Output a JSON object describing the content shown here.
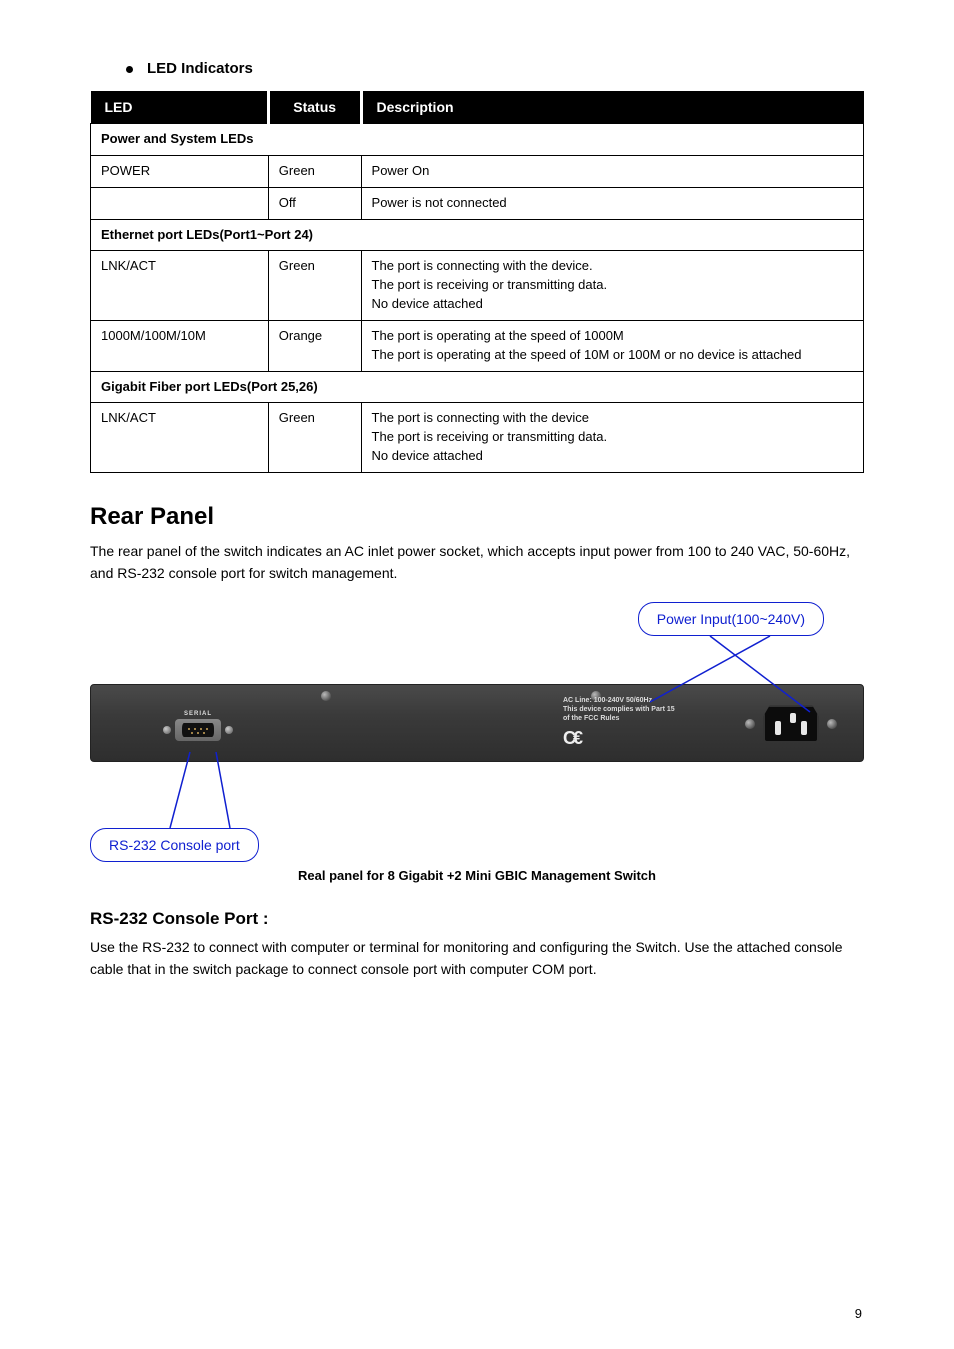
{
  "led_section": {
    "bullet_label": "LED Indicators",
    "columns": {
      "led": "LED",
      "status": "Status",
      "description": "Description"
    },
    "groups": [
      {
        "title": "Power and System LEDs",
        "rows": [
          {
            "led": "POWER",
            "status": "Green",
            "desc": "Power On"
          },
          {
            "led": "",
            "status": "Off",
            "desc": "Power is not connected"
          }
        ]
      },
      {
        "title": "Ethernet port LEDs(Port1~Port 24)",
        "rows": [
          {
            "led": "LNK/ACT",
            "status": "Green",
            "desc": "The port is connecting with the device.\nThe port is receiving or transmitting data.\nNo device attached"
          },
          {
            "led": "1000M/100M/10M",
            "status": "Orange",
            "desc": "The port is operating at the speed of 1000M\nThe port is operating at the speed of 10M or 100M or no device is attached"
          }
        ]
      },
      {
        "title": "Gigabit Fiber port LEDs(Port 25,26)",
        "rows": [
          {
            "led": "LNK/ACT",
            "status": "Green",
            "desc": "The port is connecting with the device\nThe port is receiving or transmitting data.\nNo device attached"
          }
        ]
      }
    ]
  },
  "rear": {
    "heading": "Rear Panel",
    "text": "The rear panel of the switch indicates an AC inlet power socket, which accepts input power from 100 to 240 VAC, 50-60Hz, and RS-232 console port for switch management.",
    "callout_top": "Power Input(100~240V)",
    "callout_bottom": "RS-232 Console port",
    "serial_label": "SERIAL",
    "compliance_line1": "AC Line: 100-240V 50/60Hz",
    "compliance_line2": "This device complies with Part 15",
    "compliance_line3": "of the FCC Rules",
    "caption": "Real panel for 8 Gigabit +2 Mini GBIC Management Switch"
  },
  "console": {
    "heading": "RS-232 Console Port :",
    "text": "Use the RS-232 to connect with computer or terminal for monitoring and configuring the Switch. Use the attached console cable that in the switch package to connect console port with computer COM port."
  },
  "page": "9"
}
